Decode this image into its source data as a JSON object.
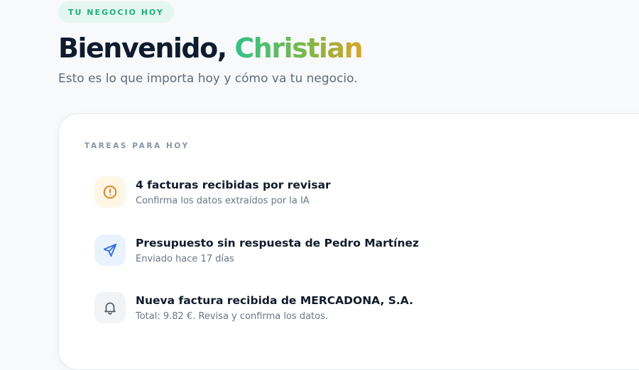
{
  "badge": "TU NEGOCIO HOY",
  "header": {
    "greeting": "Bienvenido,",
    "name": "Christian",
    "subtitle": "Esto es lo que importa hoy y cómo va tu negocio."
  },
  "tasks_card": {
    "label": "TAREAS PARA HOY",
    "items": [
      {
        "title": "4 facturas recibidas por revisar",
        "subtitle": "Confirma los datos extraídos por la IA",
        "icon": "alert-circle-icon",
        "icon_color": "#e07b12",
        "icon_bg": "#fff6e6"
      },
      {
        "title": "Presupuesto sin respuesta de Pedro Martínez",
        "subtitle": "Enviado hace 17 días",
        "icon": "send-icon",
        "icon_color": "#2f6fe0",
        "icon_bg": "#eaf2fd"
      },
      {
        "title": "Nueva factura recibida de MERCADONA, S.A.",
        "subtitle": "Total: 9.82 €. Revisa y confirma los datos.",
        "icon": "bell-icon",
        "icon_color": "#4f5867",
        "icon_bg": "#f1f3f6"
      }
    ]
  },
  "colors": {
    "accent_green": "#1fae7e",
    "name_gradient": [
      "#31c28a",
      "#7ab84a",
      "#d9a429"
    ],
    "title": "#0f1b2e"
  }
}
